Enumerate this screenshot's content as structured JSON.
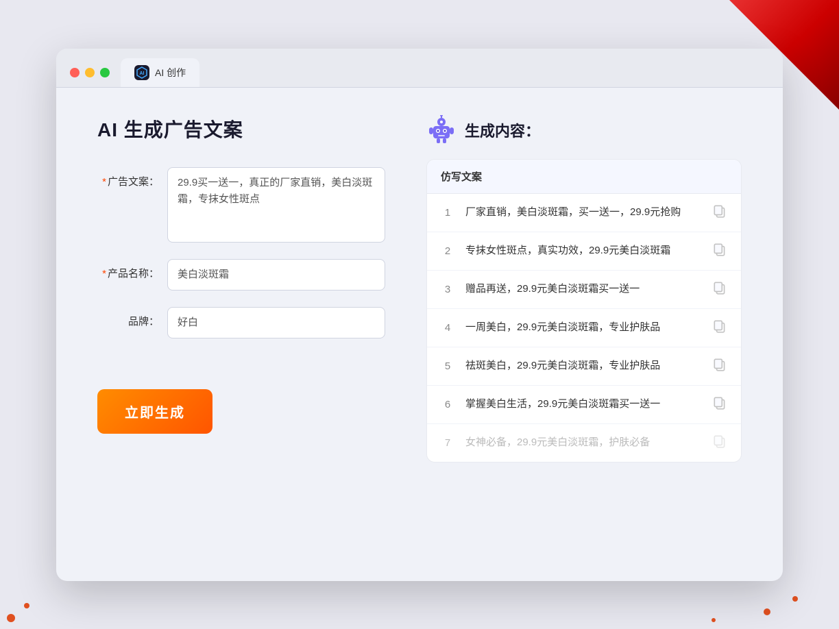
{
  "decorative": {
    "corner": "top-right red triangle"
  },
  "browser": {
    "tab_label": "AI 创作",
    "tab_icon": "AI"
  },
  "left_panel": {
    "title": "AI 生成广告文案",
    "fields": {
      "ad_copy": {
        "label": "广告文案：",
        "required": true,
        "value": "29.9买一送一，真正的厂家直销，美白淡斑霜，专抹女性斑点"
      },
      "product_name": {
        "label": "产品名称：",
        "required": true,
        "value": "美白淡斑霜"
      },
      "brand": {
        "label": "品牌：",
        "required": false,
        "value": "好白"
      }
    },
    "generate_button": "立即生成"
  },
  "right_panel": {
    "header": "生成内容：",
    "table_header": "仿写文案",
    "results": [
      {
        "num": "1",
        "text": "厂家直销，美白淡斑霜，买一送一，29.9元抢购",
        "muted": false
      },
      {
        "num": "2",
        "text": "专抹女性斑点，真实功效，29.9元美白淡斑霜",
        "muted": false
      },
      {
        "num": "3",
        "text": "赠品再送，29.9元美白淡斑霜买一送一",
        "muted": false
      },
      {
        "num": "4",
        "text": "一周美白，29.9元美白淡斑霜，专业护肤品",
        "muted": false
      },
      {
        "num": "5",
        "text": "祛斑美白，29.9元美白淡斑霜，专业护肤品",
        "muted": false
      },
      {
        "num": "6",
        "text": "掌握美白生活，29.9元美白淡斑霜买一送一",
        "muted": false
      },
      {
        "num": "7",
        "text": "女神必备，29.9元美白淡斑霜，护肤必备",
        "muted": true
      }
    ]
  }
}
